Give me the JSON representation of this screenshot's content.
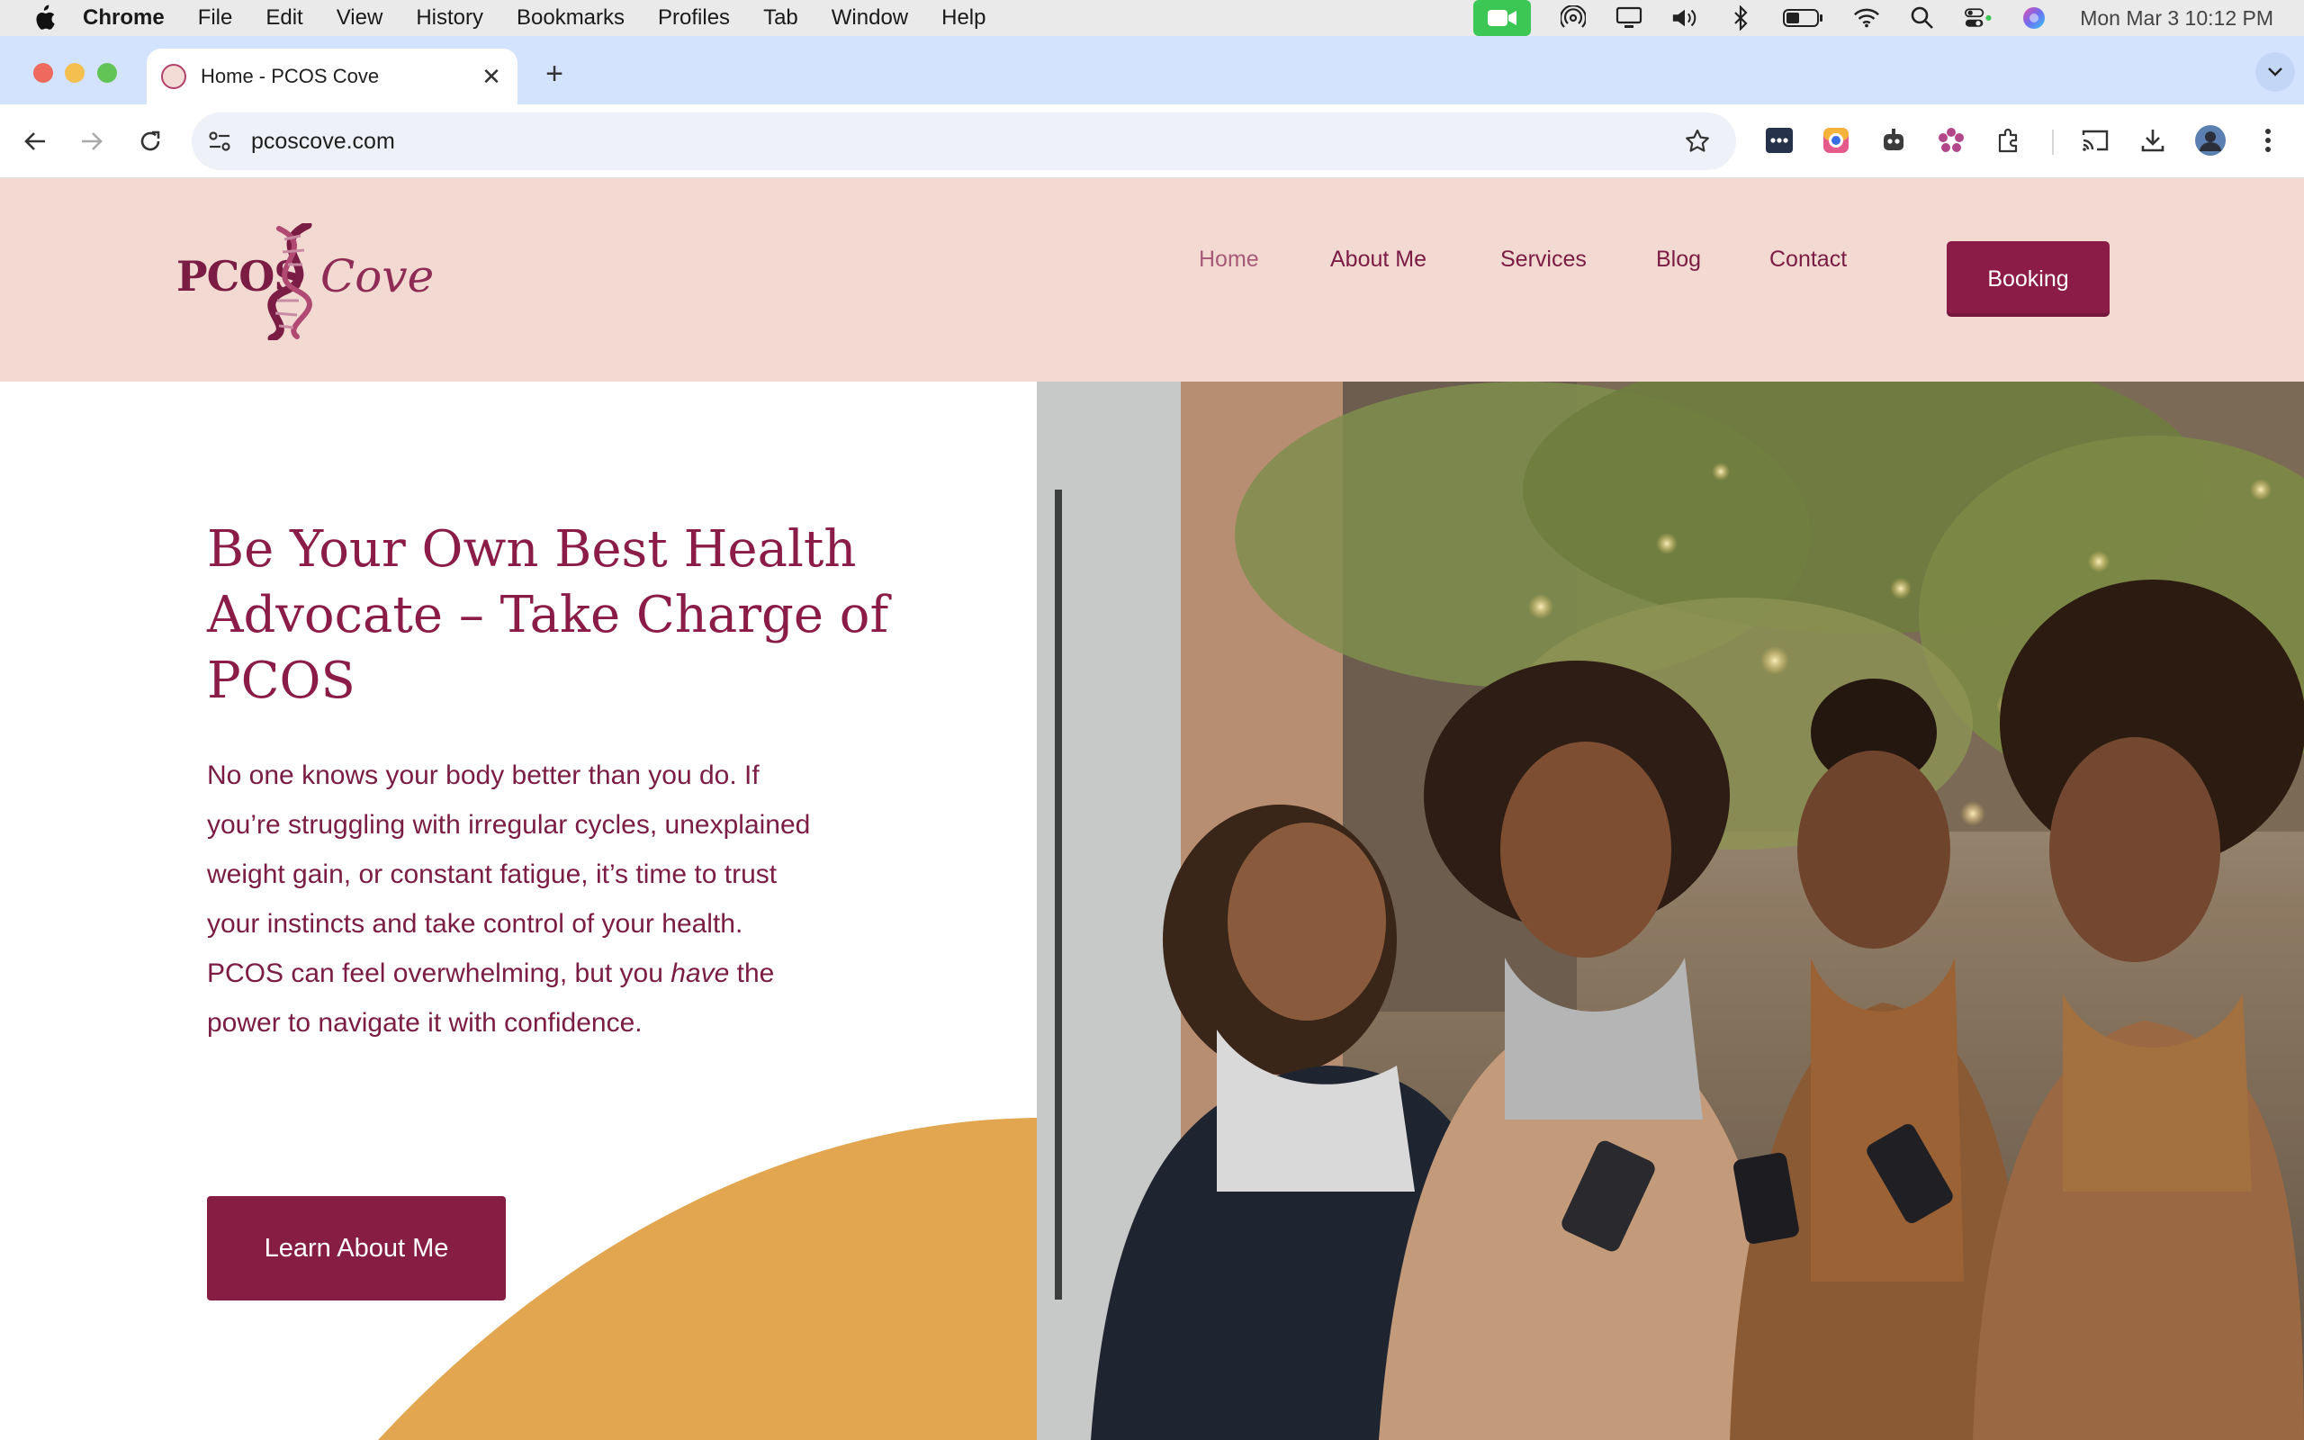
{
  "menubar": {
    "app_name": "Chrome",
    "items": [
      "File",
      "Edit",
      "View",
      "History",
      "Bookmarks",
      "Profiles",
      "Tab",
      "Window",
      "Help"
    ],
    "clock": "Mon Mar 3  10:12 PM",
    "status_icons": [
      "facetime-camera-icon",
      "airdrop-icon",
      "display-icon",
      "volume-icon",
      "bluetooth-icon",
      "battery-icon",
      "wifi-icon",
      "spotlight-search-icon",
      "control-center-icon",
      "siri-icon"
    ]
  },
  "browser": {
    "tab_title": "Home - PCOS Cove",
    "url": "pcoscove.com",
    "extension_icons": [
      "extension-dark-icon",
      "extension-camera-icon",
      "extension-robot-icon",
      "extension-flower-icon",
      "puzzle-extensions-icon"
    ]
  },
  "site": {
    "logo": {
      "left_text": "PCOS",
      "right_text": "Cove"
    },
    "nav": [
      "Home",
      "About Me",
      "Services",
      "Blog",
      "Contact"
    ],
    "active_nav": "Home",
    "booking_label": "Booking",
    "colors": {
      "header_bg": "#f2dad3",
      "brand": "#8b1c48",
      "accent_orange": "#e2a550"
    }
  },
  "hero": {
    "headline": "Be Your Own Best Health Advocate – Take Charge of PCOS",
    "lead_before": "No one knows your body better than you do. If you’re struggling with irregular cycles, unexplained weight gain, or constant fatigue, it’s time to trust your instincts and take control of your health. PCOS can feel overwhelming, but you ",
    "lead_emphasis": "have",
    "lead_after": " the power to navigate it with confidence.",
    "cta_label": "Learn About Me"
  }
}
